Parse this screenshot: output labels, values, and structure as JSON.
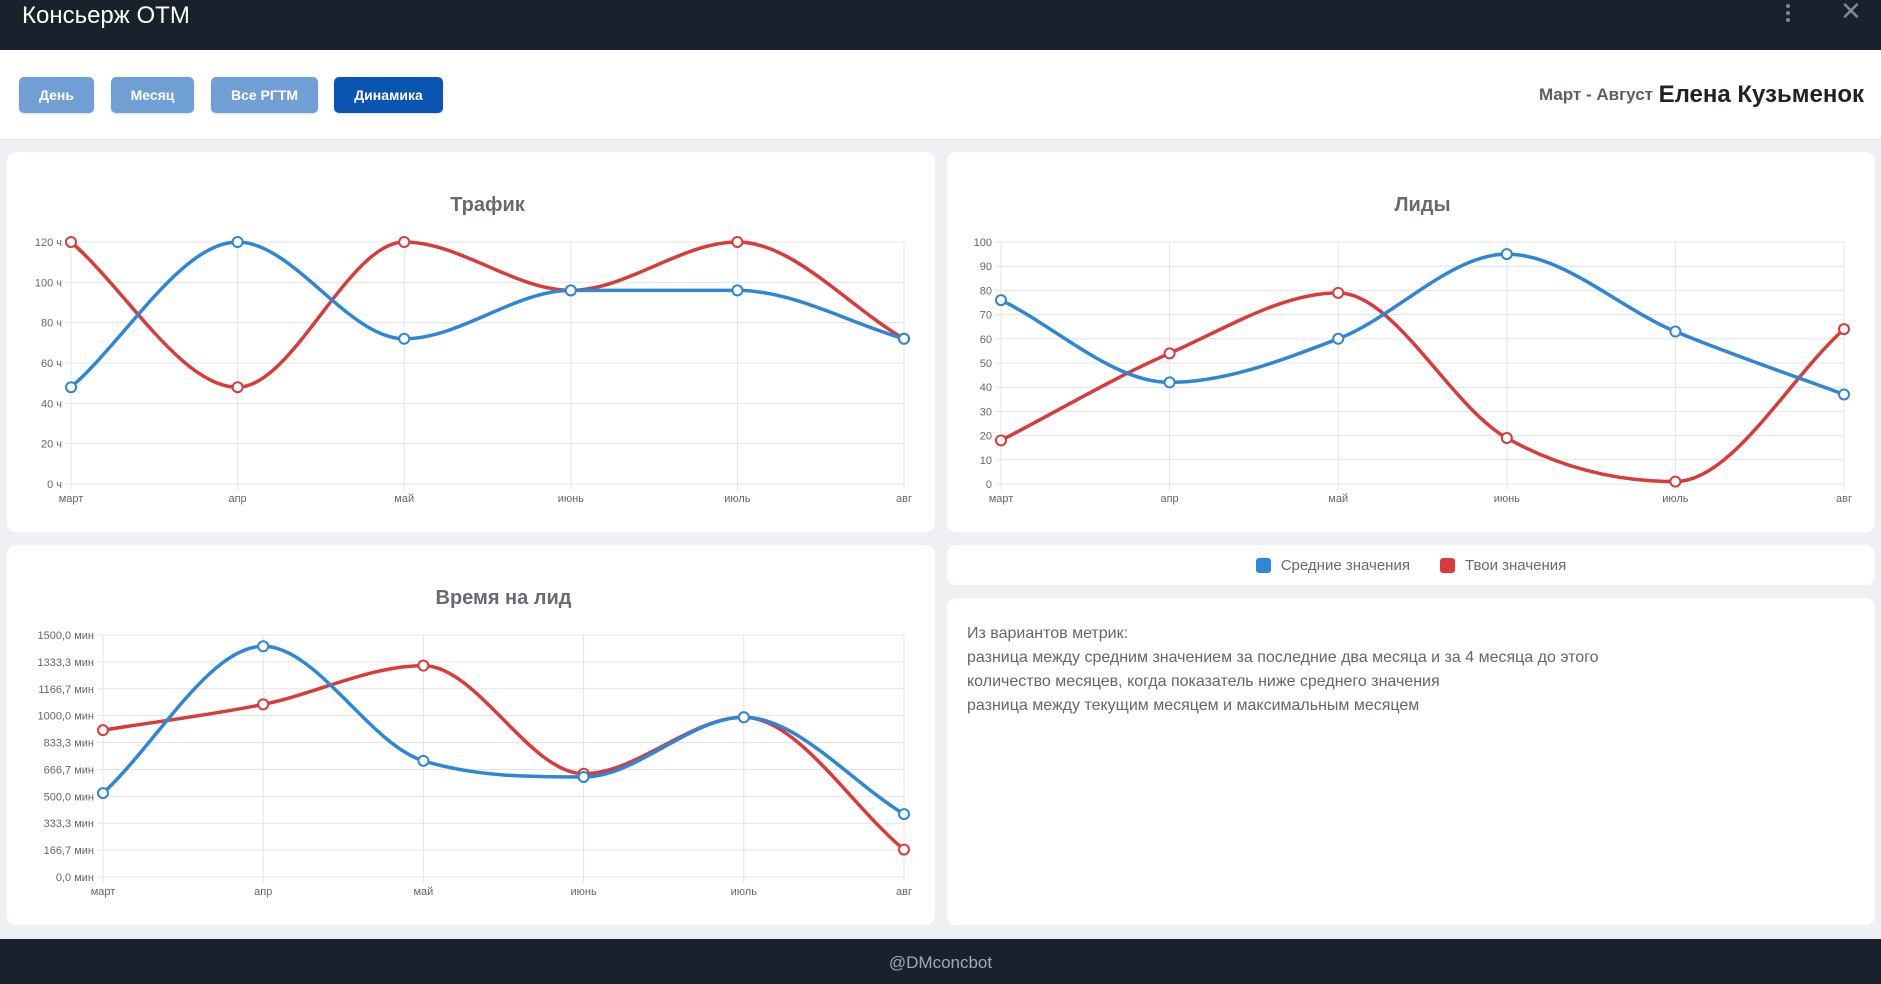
{
  "app": {
    "title": "Консьерж ОТМ"
  },
  "window": {
    "menu_icon": "vertical-dots-icon",
    "close_icon": "close-icon",
    "close_glyph": "✕"
  },
  "toolbar": {
    "tabs": [
      {
        "label": "День"
      },
      {
        "label": "Месяц"
      },
      {
        "label": "Все РГТМ"
      },
      {
        "label": "Динамика",
        "active": true
      }
    ],
    "period": "Март - Август",
    "user": "Елена Кузьменок"
  },
  "colors": {
    "avg": "#2e86d6",
    "yours": "#d93a3a",
    "active_tab": "#0a54b2",
    "tab": "#6f9fd5",
    "header": "#19212d"
  },
  "legend": {
    "avg_label": "Средние значения",
    "yours_label": "Твои значения"
  },
  "notes": {
    "lines": [
      "Из вариантов метрик:",
      "разница между средним значением за последние два месяца и за 4 месяца до этого",
      "количество месяцев, когда показатель ниже среднего значения",
      "разница между текущим месяцем и максимальным месяцем"
    ]
  },
  "footer": {
    "credit": "@DMconcbot"
  },
  "chart_data": [
    {
      "id": "traffic",
      "type": "line",
      "title": "Трафик",
      "categories": [
        "март",
        "апр",
        "май",
        "июнь",
        "июль",
        "авг"
      ],
      "yticks": [
        "0 ч",
        "20 ч",
        "40 ч",
        "60 ч",
        "80 ч",
        "100 ч",
        "120 ч"
      ],
      "ylim": [
        0,
        120
      ],
      "grid": true,
      "series": [
        {
          "name": "Средние значения",
          "values": [
            48,
            120,
            72,
            96,
            96,
            72
          ]
        },
        {
          "name": "Твои значения",
          "values": [
            120,
            48,
            120,
            96,
            120,
            72
          ]
        }
      ]
    },
    {
      "id": "leads",
      "type": "line",
      "title": "Лиды",
      "categories": [
        "март",
        "апр",
        "май",
        "июнь",
        "июль",
        "авг"
      ],
      "yticks": [
        "0",
        "10",
        "20",
        "30",
        "40",
        "50",
        "60",
        "70",
        "80",
        "90",
        "100"
      ],
      "ylim": [
        0,
        100
      ],
      "grid": true,
      "series": [
        {
          "name": "Средние значения",
          "values": [
            76,
            42,
            60,
            95,
            63,
            37
          ]
        },
        {
          "name": "Твои значения",
          "values": [
            18,
            54,
            79,
            19,
            1,
            64
          ]
        }
      ]
    },
    {
      "id": "time_per_lead",
      "type": "line",
      "title": "Время на лид",
      "categories": [
        "март",
        "апр",
        "май",
        "июнь",
        "июль",
        "авг"
      ],
      "yticks": [
        "0,0 мин",
        "166,7 мин",
        "333,3 мин",
        "500,0 мин",
        "666,7 мин",
        "833,3 мин",
        "1000,0 мин",
        "1166,7 мин",
        "1333,3 мин",
        "1500,0 мин"
      ],
      "ylim": [
        0,
        1500
      ],
      "grid": true,
      "series": [
        {
          "name": "Средние значения",
          "values": [
            520,
            1430,
            720,
            620,
            990,
            390
          ]
        },
        {
          "name": "Твои значения",
          "values": [
            910,
            1070,
            1310,
            640,
            990,
            170
          ]
        }
      ]
    }
  ]
}
